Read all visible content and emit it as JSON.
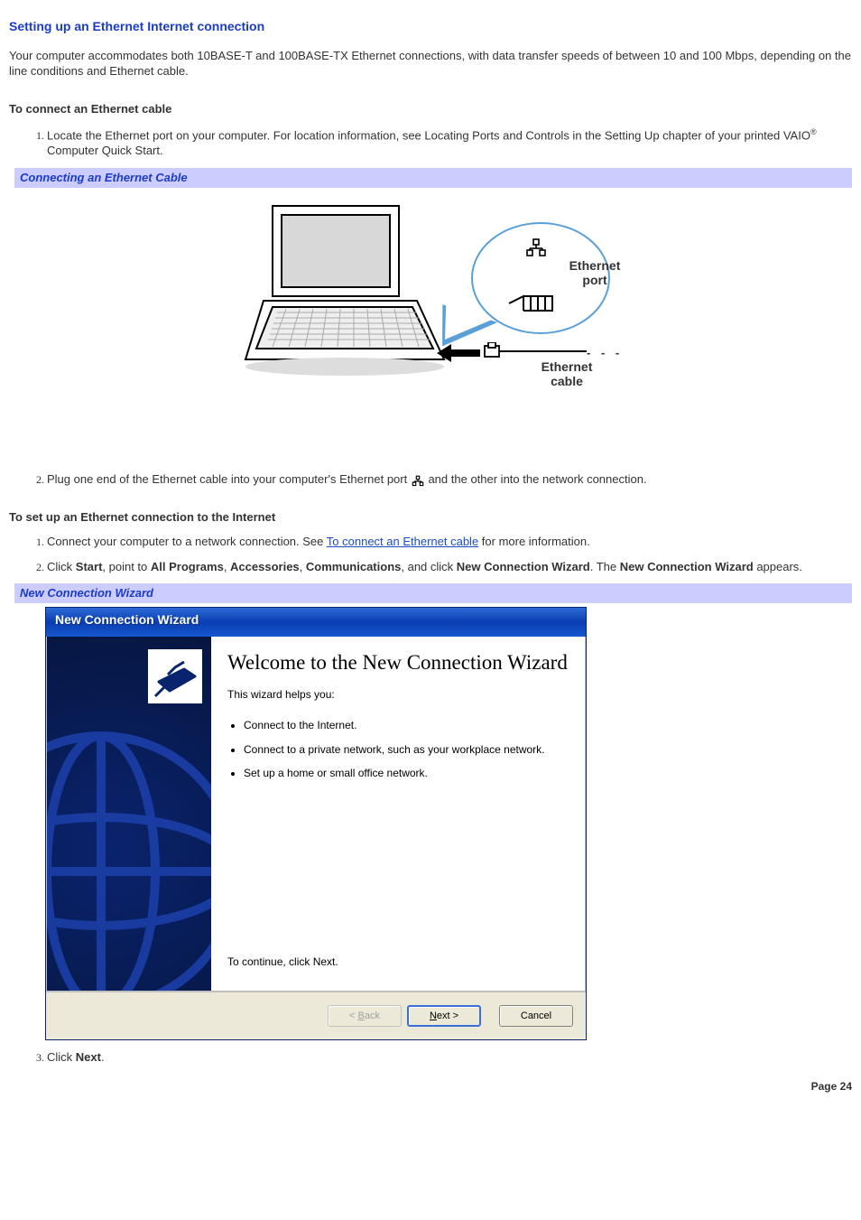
{
  "title": "Setting up an Ethernet Internet connection",
  "intro": "Your computer accommodates both 10BASE-T and 100BASE-TX Ethernet connections, with data transfer speeds of between 10 and 100 Mbps, depending on the line conditions and Ethernet cable.",
  "section1_heading": "To connect an Ethernet cable",
  "step_a1_a": "Locate the Ethernet port on your computer. For location information, see Locating Ports and Controls in the Setting Up chapter of your printed VAIO",
  "step_a1_b": " Computer Quick Start.",
  "reg_mark": "®",
  "caption1": "Connecting an Ethernet Cable",
  "diagram": {
    "port_label": "Ethernet port",
    "cable_label": "Ethernet cable"
  },
  "step_a2_a": "Plug one end of the Ethernet cable into your computer's Ethernet port ",
  "step_a2_b": " and the other into the network connection.",
  "section2_heading": "To set up an Ethernet connection to the Internet",
  "step_b1_a": "Connect your computer to a network connection. See ",
  "step_b1_link": "To connect an Ethernet cable",
  "step_b1_b": " for more information.",
  "step_b2_a": "Click ",
  "step_b2_start": "Start",
  "step_b2_b": ", point to ",
  "step_b2_allprog": "All Programs",
  "step_b2_c": ", ",
  "step_b2_acc": "Accessories",
  "step_b2_d": ", ",
  "step_b2_comm": "Communications",
  "step_b2_e": ", and click ",
  "step_b2_ncw": "New Connection Wizard",
  "step_b2_f": ". The ",
  "step_b2_ncw2": "New Connection Wizard",
  "step_b2_g": " appears.",
  "caption2": "New Connection Wizard",
  "wizard": {
    "titlebar": "New Connection Wizard",
    "welcome": "Welcome to the New Connection Wizard",
    "helps": "This wizard helps you:",
    "items": [
      "Connect to the Internet.",
      "Connect to a private network, such as your workplace network.",
      "Set up a home or small office network."
    ],
    "continue": "To continue, click Next.",
    "back": "< Back",
    "next": "Next >",
    "cancel": "Cancel"
  },
  "step_b3_a": "Click ",
  "step_b3_next": "Next",
  "step_b3_b": ".",
  "page_label": "Page 24"
}
